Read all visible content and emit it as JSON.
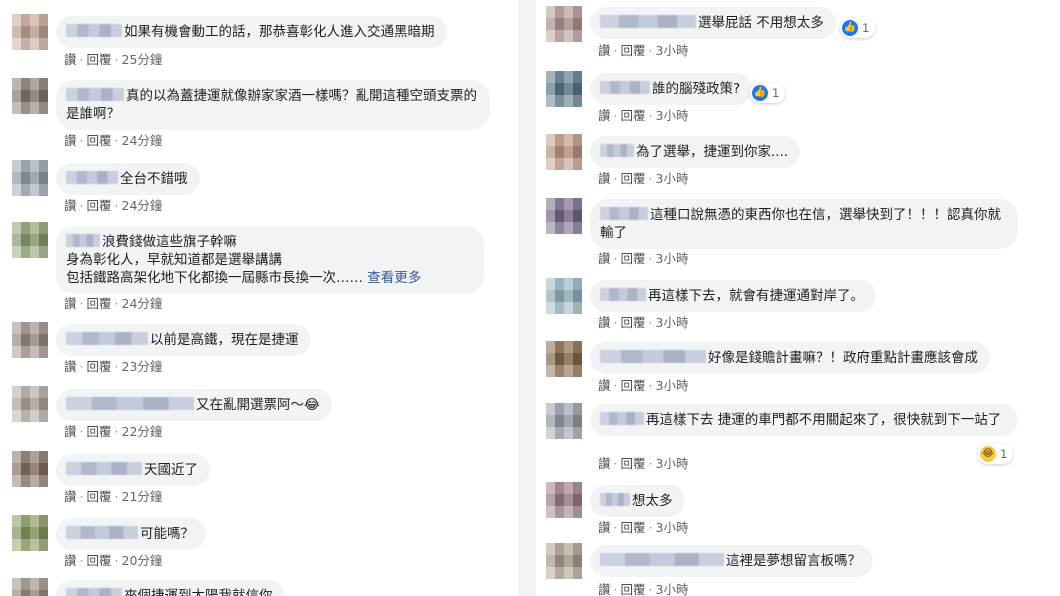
{
  "actions": {
    "like": "讚",
    "reply": "回覆",
    "dot": "·"
  },
  "left_comments": [
    {
      "text": "如果有機會動工的話，那恭喜彰化人進入交通黑暗期",
      "time": "25分鐘"
    },
    {
      "text": "真的以為蓋捷運就像辦家家酒一樣嗎？亂開這種空頭支票的是誰啊？",
      "time": "24分鐘"
    },
    {
      "text": "全台不錯哦",
      "time": "24分鐘"
    },
    {
      "line1": "浪費錢做這些旗子幹嘛",
      "line2": "身為彰化人，早就知道都是選舉講講",
      "line3": "包括鐵路高架化地下化都換一屆縣市長換一次……",
      "see_more": "查看更多",
      "time": "24分鐘"
    },
    {
      "text": "以前是高鐵，現在是捷運",
      "time": "23分鐘"
    },
    {
      "text": "又在亂開選票阿～😂",
      "time": "22分鐘"
    },
    {
      "text": "天國近了",
      "time": "21分鐘"
    },
    {
      "text": "可能嗎？",
      "time": "20分鐘"
    },
    {
      "text": "來個捷運到太陽我就信你"
    }
  ],
  "right_comments": [
    {
      "text": "選舉屁話 不用想太多",
      "time": "3小時",
      "reaction_count": "1",
      "reaction": "like-icon"
    },
    {
      "text": "誰的腦殘政策?",
      "time": "3小時",
      "reaction_count": "1",
      "reaction": "like-icon"
    },
    {
      "text": "為了選舉，捷運到你家....",
      "time": "3小時"
    },
    {
      "text": "這種口說無憑的東西你也在信，選舉快到了！！！認真你就輸了",
      "time": "3小時"
    },
    {
      "text": "再這樣下去，就會有捷運通對岸了。",
      "time": "3小時"
    },
    {
      "text": "好像是錢贍計畫嘛？！政府重點計畫應該會成",
      "time": "3小時"
    },
    {
      "text": "再這樣下去 捷運的車門都不用關起來了，很快就到下一站了",
      "time": "3小時",
      "reaction_count": "1",
      "reaction": "haha-icon"
    },
    {
      "text": "想太多",
      "time": "3小時"
    },
    {
      "text": "這裡是夢想留言板嗎？",
      "time": "3小時"
    }
  ],
  "colors": {
    "link": "#385898",
    "bubble": "#f2f3f5",
    "like": "#1877f2"
  }
}
